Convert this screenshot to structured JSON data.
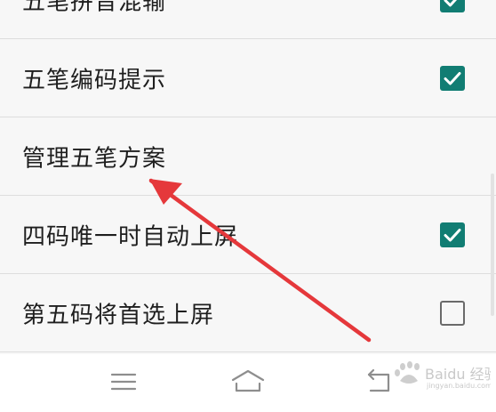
{
  "settings": {
    "items": [
      {
        "label": "五笔拼音混输",
        "checked": true
      },
      {
        "label": "五笔编码提示",
        "checked": true
      },
      {
        "label": "管理五笔方案",
        "checked": null
      },
      {
        "label": "四码唯一时自动上屏",
        "checked": true
      },
      {
        "label": "第五码将首选上屏",
        "checked": false
      }
    ]
  },
  "nav": {
    "buttons": [
      "menu-icon",
      "home-icon",
      "back-icon"
    ]
  },
  "watermark": {
    "text": "Baidu 经验",
    "url": "jingyan.baidu.com"
  },
  "colors": {
    "accent": "#117d73",
    "arrow": "#e5383b",
    "text": "#1e1e1e",
    "background": "#f7f7f7"
  }
}
